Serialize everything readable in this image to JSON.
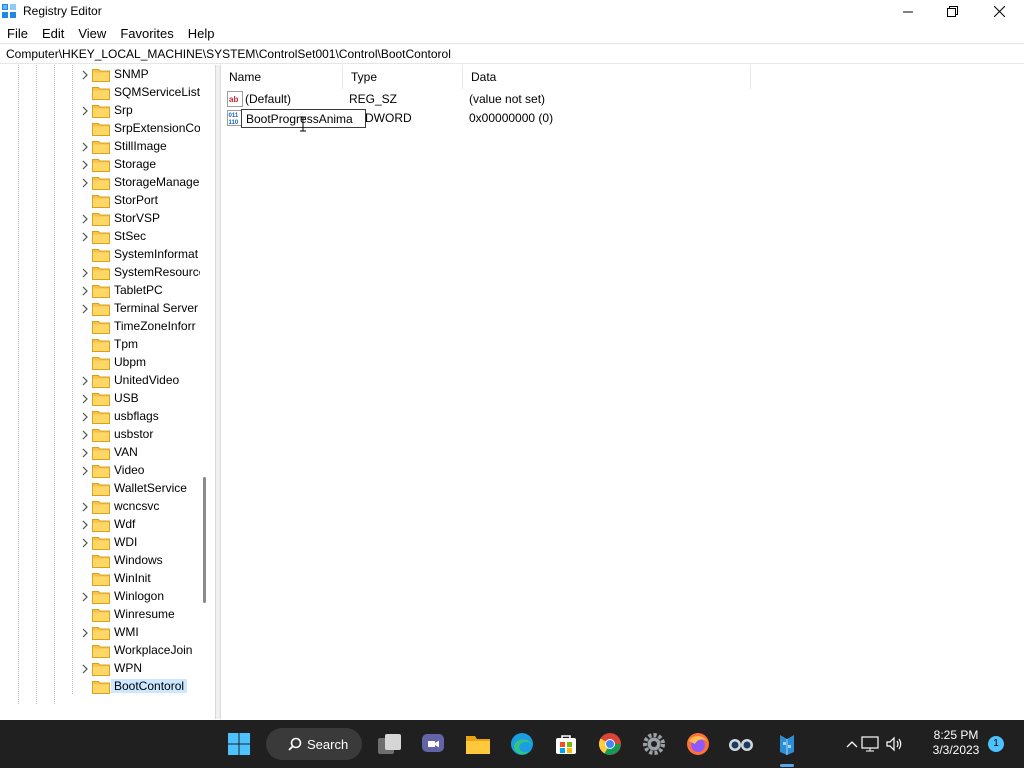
{
  "window": {
    "title": "Registry Editor",
    "icon": "registry-editor-icon"
  },
  "menu": [
    "File",
    "Edit",
    "View",
    "Favorites",
    "Help"
  ],
  "address": "Computer\\HKEY_LOCAL_MACHINE\\SYSTEM\\ControlSet001\\Control\\BootContorol",
  "tree": {
    "items": [
      {
        "label": "SNMP",
        "expandable": true
      },
      {
        "label": "SQMServiceList",
        "expandable": false
      },
      {
        "label": "Srp",
        "expandable": true
      },
      {
        "label": "SrpExtensionCo",
        "expandable": false
      },
      {
        "label": "StillImage",
        "expandable": true
      },
      {
        "label": "Storage",
        "expandable": true
      },
      {
        "label": "StorageManage",
        "expandable": true
      },
      {
        "label": "StorPort",
        "expandable": false
      },
      {
        "label": "StorVSP",
        "expandable": true
      },
      {
        "label": "StSec",
        "expandable": true
      },
      {
        "label": "SystemInformat",
        "expandable": false
      },
      {
        "label": "SystemResource",
        "expandable": true
      },
      {
        "label": "TabletPC",
        "expandable": true
      },
      {
        "label": "Terminal Server",
        "expandable": true
      },
      {
        "label": "TimeZoneInforr",
        "expandable": false
      },
      {
        "label": "Tpm",
        "expandable": false
      },
      {
        "label": "Ubpm",
        "expandable": false
      },
      {
        "label": "UnitedVideo",
        "expandable": true
      },
      {
        "label": "USB",
        "expandable": true
      },
      {
        "label": "usbflags",
        "expandable": true
      },
      {
        "label": "usbstor",
        "expandable": true
      },
      {
        "label": "VAN",
        "expandable": true
      },
      {
        "label": "Video",
        "expandable": true
      },
      {
        "label": "WalletService",
        "expandable": false
      },
      {
        "label": "wcncsvc",
        "expandable": true
      },
      {
        "label": "Wdf",
        "expandable": true
      },
      {
        "label": "WDI",
        "expandable": true
      },
      {
        "label": "Windows",
        "expandable": false
      },
      {
        "label": "WinInit",
        "expandable": false
      },
      {
        "label": "Winlogon",
        "expandable": true
      },
      {
        "label": "Winresume",
        "expandable": false
      },
      {
        "label": "WMI",
        "expandable": true
      },
      {
        "label": "WorkplaceJoin",
        "expandable": false
      },
      {
        "label": "WPN",
        "expandable": true
      },
      {
        "label": "BootContorol",
        "expandable": false,
        "selected": true
      }
    ]
  },
  "list": {
    "columns": [
      "Name",
      "Type",
      "Data"
    ],
    "rows": [
      {
        "icon": "string-value-icon",
        "name": "(Default)",
        "type": "REG_SZ",
        "data": "(value not set)"
      },
      {
        "icon": "dword-value-icon",
        "name": "",
        "type": "G_DWORD",
        "data": "0x00000000 (0)"
      }
    ],
    "rename_value": "BootProgressAnima"
  },
  "taskbar": {
    "search_label": "Search",
    "time": "8:25 PM",
    "date": "3/3/2023",
    "notification_count": "1",
    "accent": "#4cc2ff"
  }
}
